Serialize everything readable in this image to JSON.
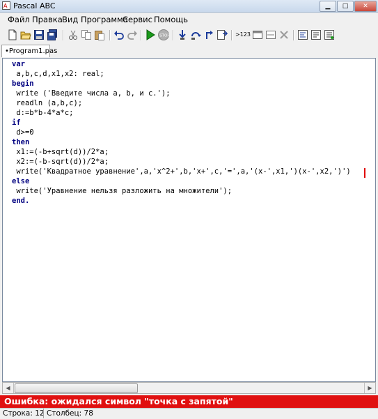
{
  "window": {
    "title": "Pascal ABC"
  },
  "menu": [
    "Файл",
    "Правка",
    "Вид",
    "Программа",
    "Сервис",
    "Помощь"
  ],
  "toolbar": {
    "buttons": [
      "new-file",
      "open-file",
      "save",
      "save-all",
      "cut",
      "copy",
      "paste",
      "undo",
      "redo",
      "run",
      "stop",
      "step-into",
      "step-over",
      "step-out",
      "run-to-cursor",
      "output-window",
      "show-output",
      "close-window",
      "format-code",
      "help-1",
      "help-2"
    ],
    "output_label": ">123"
  },
  "tabs": [
    {
      "label": "•Program1.pas"
    }
  ],
  "editor": {
    "lines": [
      "var",
      " a,b,c,d,x1,x2: real;",
      "begin",
      " write ('Введите числа a, b, и c.');",
      " readln (a,b,c);",
      " d:=b*b-4*a*c;",
      "if",
      " d>=0",
      "then",
      " x1:=(-b+sqrt(d))/2*a;",
      " x2:=(-b-sqrt(d))/2*a;",
      " write('Квадратное уравнение',a,'x^2+',b,'x+',c,'=',a,'(x-',x1,')(x-',x2,')')",
      "else",
      " write('Уравнение нельзя разложить на множители');",
      "end."
    ]
  },
  "error": {
    "message": "Ошибка: ожидался символ \"точка с запятой\""
  },
  "status": {
    "line": "Строка: 12",
    "column": "Столбец: 78"
  },
  "colors": {
    "error_bg": "#e01010",
    "keyword": "#000080",
    "string": "#0000c0",
    "caret": "#e00000"
  }
}
